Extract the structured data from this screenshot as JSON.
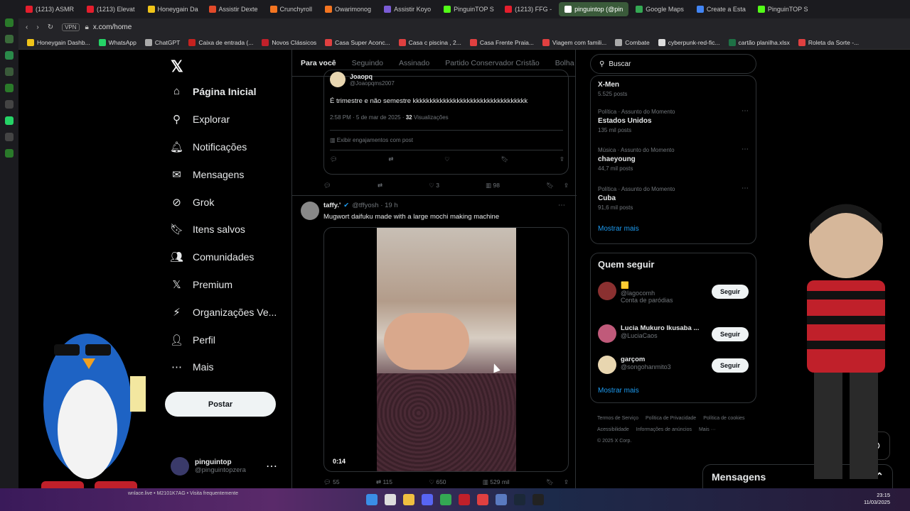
{
  "browser": {
    "tabs": [
      {
        "label": "(1213) ASMR",
        "color": "#e41e2d"
      },
      {
        "label": "(1213) Elevat",
        "color": "#e41e2d"
      },
      {
        "label": "Honeygain Da",
        "color": "#f0c419"
      },
      {
        "label": "Assistir Dexte",
        "color": "#e24a2a"
      },
      {
        "label": "Crunchyroll",
        "color": "#f47521"
      },
      {
        "label": "Owarimonog",
        "color": "#f47521"
      },
      {
        "label": "Assistir Koyo",
        "color": "#7b5cd6"
      },
      {
        "label": "PinguinTOP S",
        "color": "#53fc18"
      },
      {
        "label": "(1213) FFG -",
        "color": "#e41e2d"
      },
      {
        "label": "pinguintop (@pin",
        "color": "#ffffff",
        "active": true
      },
      {
        "label": "Google Maps",
        "color": "#34a853"
      },
      {
        "label": "Create a Esta",
        "color": "#4285f4"
      },
      {
        "label": "PinguinTOP S",
        "color": "#53fc18"
      }
    ],
    "address": "x.com/home",
    "vpn": "VPN",
    "bookmarks": [
      "Honeygain Dashb...",
      "WhatsApp",
      "ChatGPT",
      "Caixa de entrada (...",
      "Novos Clássicos",
      "Casa Super Aconc...",
      "Casa c piscina , 2...",
      "Casa Frente Praia...",
      "Viagem com famili...",
      "Combate",
      "cyberpunk-red-fic...",
      "cartão planilha.xlsx",
      "Roleta da Sorte -..."
    ]
  },
  "nav": {
    "items": [
      {
        "label": "Página Inicial",
        "icon": "home-icon",
        "glyph": "⌂"
      },
      {
        "label": "Explorar",
        "icon": "search-icon",
        "glyph": "⚲"
      },
      {
        "label": "Notificações",
        "icon": "bell-icon",
        "glyph": "🔔︎"
      },
      {
        "label": "Mensagens",
        "icon": "mail-icon",
        "glyph": "✉"
      },
      {
        "label": "Grok",
        "icon": "grok-icon",
        "glyph": "⊘"
      },
      {
        "label": "Itens salvos",
        "icon": "bookmark-icon",
        "glyph": "🔖︎"
      },
      {
        "label": "Comunidades",
        "icon": "communities-icon",
        "glyph": "👥︎"
      },
      {
        "label": "Premium",
        "icon": "x-premium-icon",
        "glyph": "𝕏"
      },
      {
        "label": "Organizações Ve...",
        "icon": "lightning-icon",
        "glyph": "⚡︎"
      },
      {
        "label": "Perfil",
        "icon": "person-icon",
        "glyph": "👤︎"
      },
      {
        "label": "Mais",
        "icon": "more-icon",
        "glyph": "⋯"
      }
    ],
    "post_label": "Postar",
    "profile_name": "pinguintop",
    "profile_handle": "@pinguintopzera"
  },
  "timeline": {
    "tabs": [
      "Para você",
      "Seguindo",
      "Assinado",
      "Partido Conservador Cristão",
      "Bolha A"
    ],
    "quote": {
      "name": "Joaopq",
      "handle": "@Joaopqms2007",
      "text": "É trimestre e não semestre kkkkkkkkkkkkkkkkkkkkkkkkkkkkkkkkkk",
      "time": "2:58 PM · 5 de mar de 2025 ·",
      "views_count": "32",
      "views_label": "Visualizações",
      "engagement": "Exibir engajamentos com post"
    },
    "tweet1_stats": {
      "likes": "3",
      "views": "98"
    },
    "tweet2": {
      "name": "taffy.'",
      "handle": "@tffyosh · 19 h",
      "text": "Mugwort daifuku made with a large mochi making machine",
      "video_time": "0:14",
      "replies": "55",
      "retweets": "115",
      "likes": "650",
      "views": "529 mil"
    }
  },
  "sidebar": {
    "search_placeholder": "Buscar",
    "trends": [
      {
        "meta": "",
        "name": "X-Men",
        "count": "5.525 posts"
      },
      {
        "meta": "Política · Assunto do Momento",
        "name": "Estados Unidos",
        "count": "135 mil posts"
      },
      {
        "meta": "Música · Assunto do Momento",
        "name": "chaeyoung",
        "count": "44,7 mil posts"
      },
      {
        "meta": "Política · Assunto do Momento",
        "name": "Cuba",
        "count": "91,6 mil posts"
      }
    ],
    "show_more": "Mostrar mais",
    "follow_title": "Quem seguir",
    "follow": [
      {
        "name": "🟨",
        "handle": "@lagocomh",
        "extra": "Conta de paródias",
        "button": "Seguir",
        "color": "#8a3030"
      },
      {
        "name": "Lucia Mukuro Ikusaba ...",
        "handle": "@LuciaCaos",
        "extra": "",
        "button": "Seguir",
        "color": "#c05a7a"
      },
      {
        "name": "garçom",
        "handle": "@songohanmito3",
        "extra": "",
        "button": "Seguir",
        "color": "#e8d6b0"
      }
    ],
    "follow_more": "Mostrar mais",
    "footer": [
      "Termos de Serviço",
      "Política de Privacidade",
      "Política de cookies",
      "Acessibilidade",
      "Informações de anúncios",
      "Mais ···",
      "© 2025 X Corp."
    ]
  },
  "messages_label": "Mensagens",
  "taskbar": {
    "ticker": "wnlace.live • M2101K7AG • Visita frequentemente",
    "time": "23:15",
    "date": "11/03/2025"
  },
  "colors": {
    "accent": "#1d9bf0",
    "bg": "#000000",
    "border": "#2f3336",
    "muted": "#71767b"
  }
}
